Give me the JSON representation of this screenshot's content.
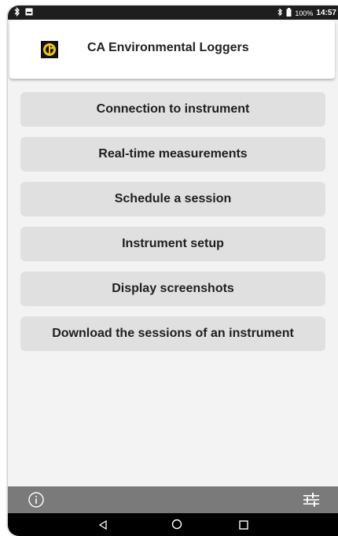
{
  "status_bar": {
    "battery_percent": "100%",
    "time": "14:57"
  },
  "app_bar": {
    "title": "CA Environmental Loggers",
    "logo_color": "#f0c419"
  },
  "menu": [
    {
      "label": "Connection to instrument"
    },
    {
      "label": "Real-time measurements"
    },
    {
      "label": "Schedule a session"
    },
    {
      "label": "Instrument setup"
    },
    {
      "label": "Display screenshots"
    },
    {
      "label": "Download the sessions of an instrument"
    }
  ],
  "bottom_toolbar": {
    "left_icon": "info-icon",
    "right_icon": "settings-sliders-icon",
    "background": "#7a7a7a"
  },
  "nav_bar": {
    "icons": [
      "back-icon",
      "home-icon",
      "recents-icon"
    ]
  }
}
